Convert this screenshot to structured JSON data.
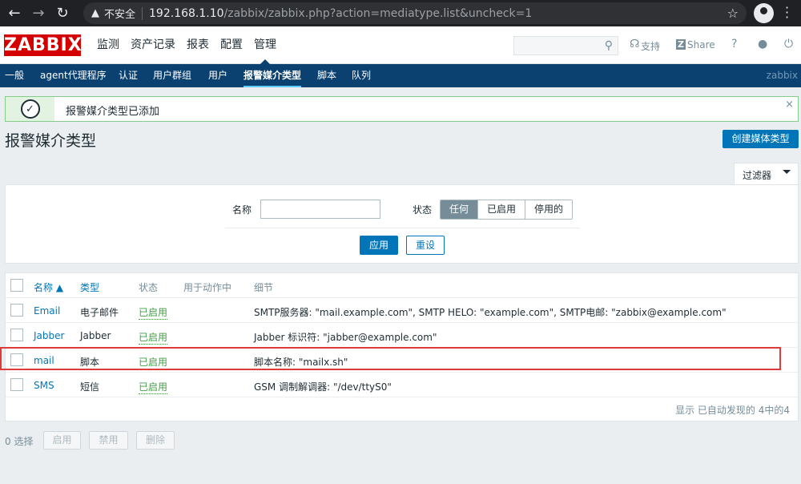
{
  "browser": {
    "insecure_label": "不安全",
    "url_host": "192.168.1.10",
    "url_rest": "/zabbix/zabbix.php?action=mediatype.list&uncheck=1"
  },
  "header": {
    "logo": "ZABBIX",
    "menu": [
      "监测",
      "资产记录",
      "报表",
      "配置",
      "管理"
    ],
    "active_menu": "管理",
    "support_label": "支持",
    "share_label": "Share",
    "help_label": "?"
  },
  "subnav": {
    "items": [
      "一般",
      "agent代理程序",
      "认证",
      "用户群组",
      "用户",
      "报警媒介类型",
      "脚本",
      "队列"
    ],
    "active": "报警媒介类型",
    "right_label": "zabbix"
  },
  "message": {
    "text": "报警媒介类型已添加",
    "close": "×"
  },
  "page": {
    "title": "报警媒介类型",
    "create_button": "创建媒体类型"
  },
  "filter": {
    "tab_label": "过滤器",
    "name_label": "名称",
    "name_value": "",
    "status_label": "状态",
    "status_options": [
      "任何",
      "已启用",
      "停用的"
    ],
    "status_selected": "任何",
    "apply_label": "应用",
    "reset_label": "重设"
  },
  "table": {
    "headers": {
      "name": "名称 ▲",
      "type": "类型",
      "status": "状态",
      "used_in_actions": "用于动作中",
      "details": "细节"
    },
    "rows": [
      {
        "name": "Email",
        "type": "电子邮件",
        "status": "已启用",
        "details": "SMTP服务器: \"mail.example.com\", SMTP HELO: \"example.com\", SMTP电邮: \"zabbix@example.com\""
      },
      {
        "name": "Jabber",
        "type": "Jabber",
        "status": "已启用",
        "details": "Jabber 标识符: \"jabber@example.com\""
      },
      {
        "name": "mail",
        "type": "脚本",
        "status": "已启用",
        "details": "脚本名称: \"mailx.sh\""
      },
      {
        "name": "SMS",
        "type": "短信",
        "status": "已启用",
        "details": "GSM 调制解调器: \"/dev/ttyS0\""
      }
    ],
    "summary": "显示 已自动发现的 4中的4"
  },
  "footer": {
    "selected": "0 选择",
    "enable_label": "启用",
    "disable_label": "禁用",
    "delete_label": "删除"
  },
  "colors": {
    "brand": "#d40000",
    "nav_bg": "#0b4170",
    "primary": "#0275b8",
    "enabled": "#429e47",
    "highlight": "#e03b3b"
  }
}
